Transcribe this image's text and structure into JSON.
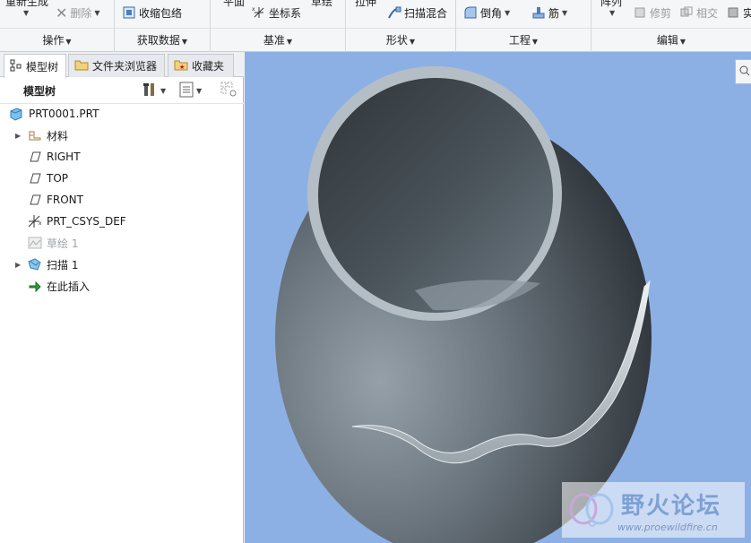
{
  "ribbon": {
    "groups": {
      "operations": "操作",
      "get_data": "获取数据",
      "datum": "基准",
      "shapes": "形状",
      "engineering": "工程",
      "editing": "编辑"
    },
    "buttons": {
      "regenerate": "重新生成",
      "delete": "删除",
      "shrinkwrap": "收缩包络",
      "plane": "平面",
      "csys": "坐标系",
      "sketch": "草绘",
      "extrude": "拉伸",
      "swept_blend": "扫描混合",
      "round": "倒角",
      "rib": "筋",
      "pattern": "阵列",
      "trim": "修剪",
      "intersect": "相交",
      "cut_right": "实"
    }
  },
  "left_panel": {
    "tabs": {
      "model_tree": "模型树",
      "folder_browser": "文件夹浏览器",
      "favorites": "收藏夹"
    },
    "tree_title": "模型树",
    "tree": [
      {
        "label": "PRT0001.PRT",
        "icon": "part-icon",
        "expandable": false,
        "dim": false
      },
      {
        "label": "材料",
        "icon": "material-icon",
        "expandable": true,
        "dim": false
      },
      {
        "label": "RIGHT",
        "icon": "datum-plane-icon",
        "expandable": false,
        "dim": false
      },
      {
        "label": "TOP",
        "icon": "datum-plane-icon",
        "expandable": false,
        "dim": false
      },
      {
        "label": "FRONT",
        "icon": "datum-plane-icon",
        "expandable": false,
        "dim": false
      },
      {
        "label": "PRT_CSYS_DEF",
        "icon": "csys-icon",
        "expandable": false,
        "dim": false
      },
      {
        "label": "草绘 1",
        "icon": "sketch-icon",
        "expandable": false,
        "dim": true
      },
      {
        "label": "扫描 1",
        "icon": "sweep-icon",
        "expandable": true,
        "dim": false
      },
      {
        "label": "在此插入",
        "icon": "insert-here-arrow-icon",
        "expandable": false,
        "dim": false
      }
    ]
  },
  "viewport": {
    "watermark_title": "野火论坛",
    "watermark_url": "www.proewildfire.cn"
  },
  "colors": {
    "viewport_bg": "#8db0e4",
    "model_dark": "#3a4046",
    "model_light": "#8c969e"
  }
}
